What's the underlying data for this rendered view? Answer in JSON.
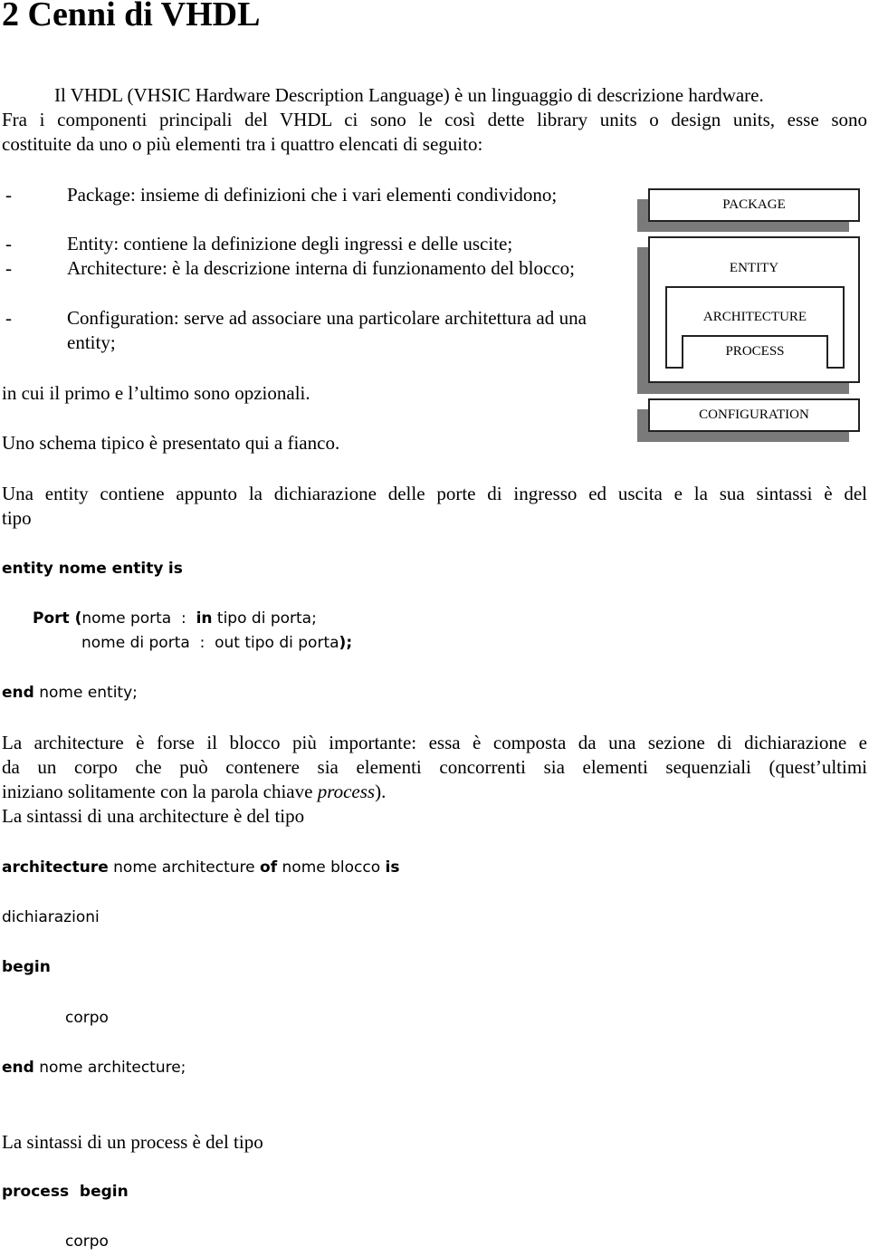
{
  "heading": "2   Cenni di VHDL",
  "intro": {
    "line1": "Il VHDL (VHSIC Hardware Description Language) è un linguaggio di descrizione hardware.",
    "line2": "Fra i componenti principali del VHDL ci sono le così dette library units o design units, esse sono",
    "line3": "costituite da uno o più elementi tra i quattro elencati di seguito:"
  },
  "list": [
    {
      "dash": "-",
      "text": "Package: insieme di definizioni che i vari elementi condividono;"
    },
    {
      "dash": "-",
      "text": "Entity: contiene la definizione degli ingressi e delle uscite;"
    },
    {
      "dash": "-",
      "text": "Architecture: è la descrizione interna di funzionamento del blocco;"
    },
    {
      "dash": "-",
      "text": "Configuration: serve ad associare una particolare architettura ad una entity;"
    }
  ],
  "optional_note": "in cui il primo e l’ultimo sono opzionali.",
  "schema_note": "Uno schema tipico è presentato qui a fianco.",
  "diagram": {
    "package": "PACKAGE",
    "entity": "ENTITY",
    "architecture": "ARCHITECTURE",
    "process": "PROCESS",
    "configuration": "CONFIGURATION"
  },
  "entity_para": {
    "line1": "Una entity contiene appunto la dichiarazione delle porte di ingresso ed uscita e la sua sintassi è del",
    "line2": "tipo"
  },
  "entity_code": {
    "l1_kw1": "entity",
    "l1_mid": " nome ",
    "l1_kw2": "entity",
    "l1_sp": " ",
    "l1_kw3": "is",
    "l2_kw": "Port",
    "l2_paren": " (",
    "l2_a": "nome porta  :  ",
    "l2_in": "in",
    "l2_b": " tipo di porta;",
    "l3_a": "nome di porta  :  out tipo di porta",
    "l3_end": ");",
    "l4_kw": "end",
    "l4_rest": " nome entity;"
  },
  "arch_para": {
    "line1": "La architecture è forse il blocco più importante: essa è composta da una sezione di dichiarazione e",
    "line2": "da un corpo che può contenere sia elementi concorrenti sia elementi sequenziali (quest’ultimi",
    "line3a": "iniziano solitamente con la parola chiave ",
    "line3_italic": "process",
    "line3b": ").",
    "line4": "La sintassi di una architecture è del tipo"
  },
  "arch_code": {
    "l1_kw1": "architecture",
    "l1_a": " nome architecture ",
    "l1_kw2": "of",
    "l1_b": " nome blocco ",
    "l1_kw3": "is",
    "l2": "dichiarazioni",
    "l3_kw": "begin",
    "l4": "corpo",
    "l5_kw": "end",
    "l5_rest": " nome architecture;"
  },
  "process_para": "La sintassi di un process è del tipo",
  "process_code": {
    "l1_kw": "process  begin",
    "l2": "corpo"
  }
}
